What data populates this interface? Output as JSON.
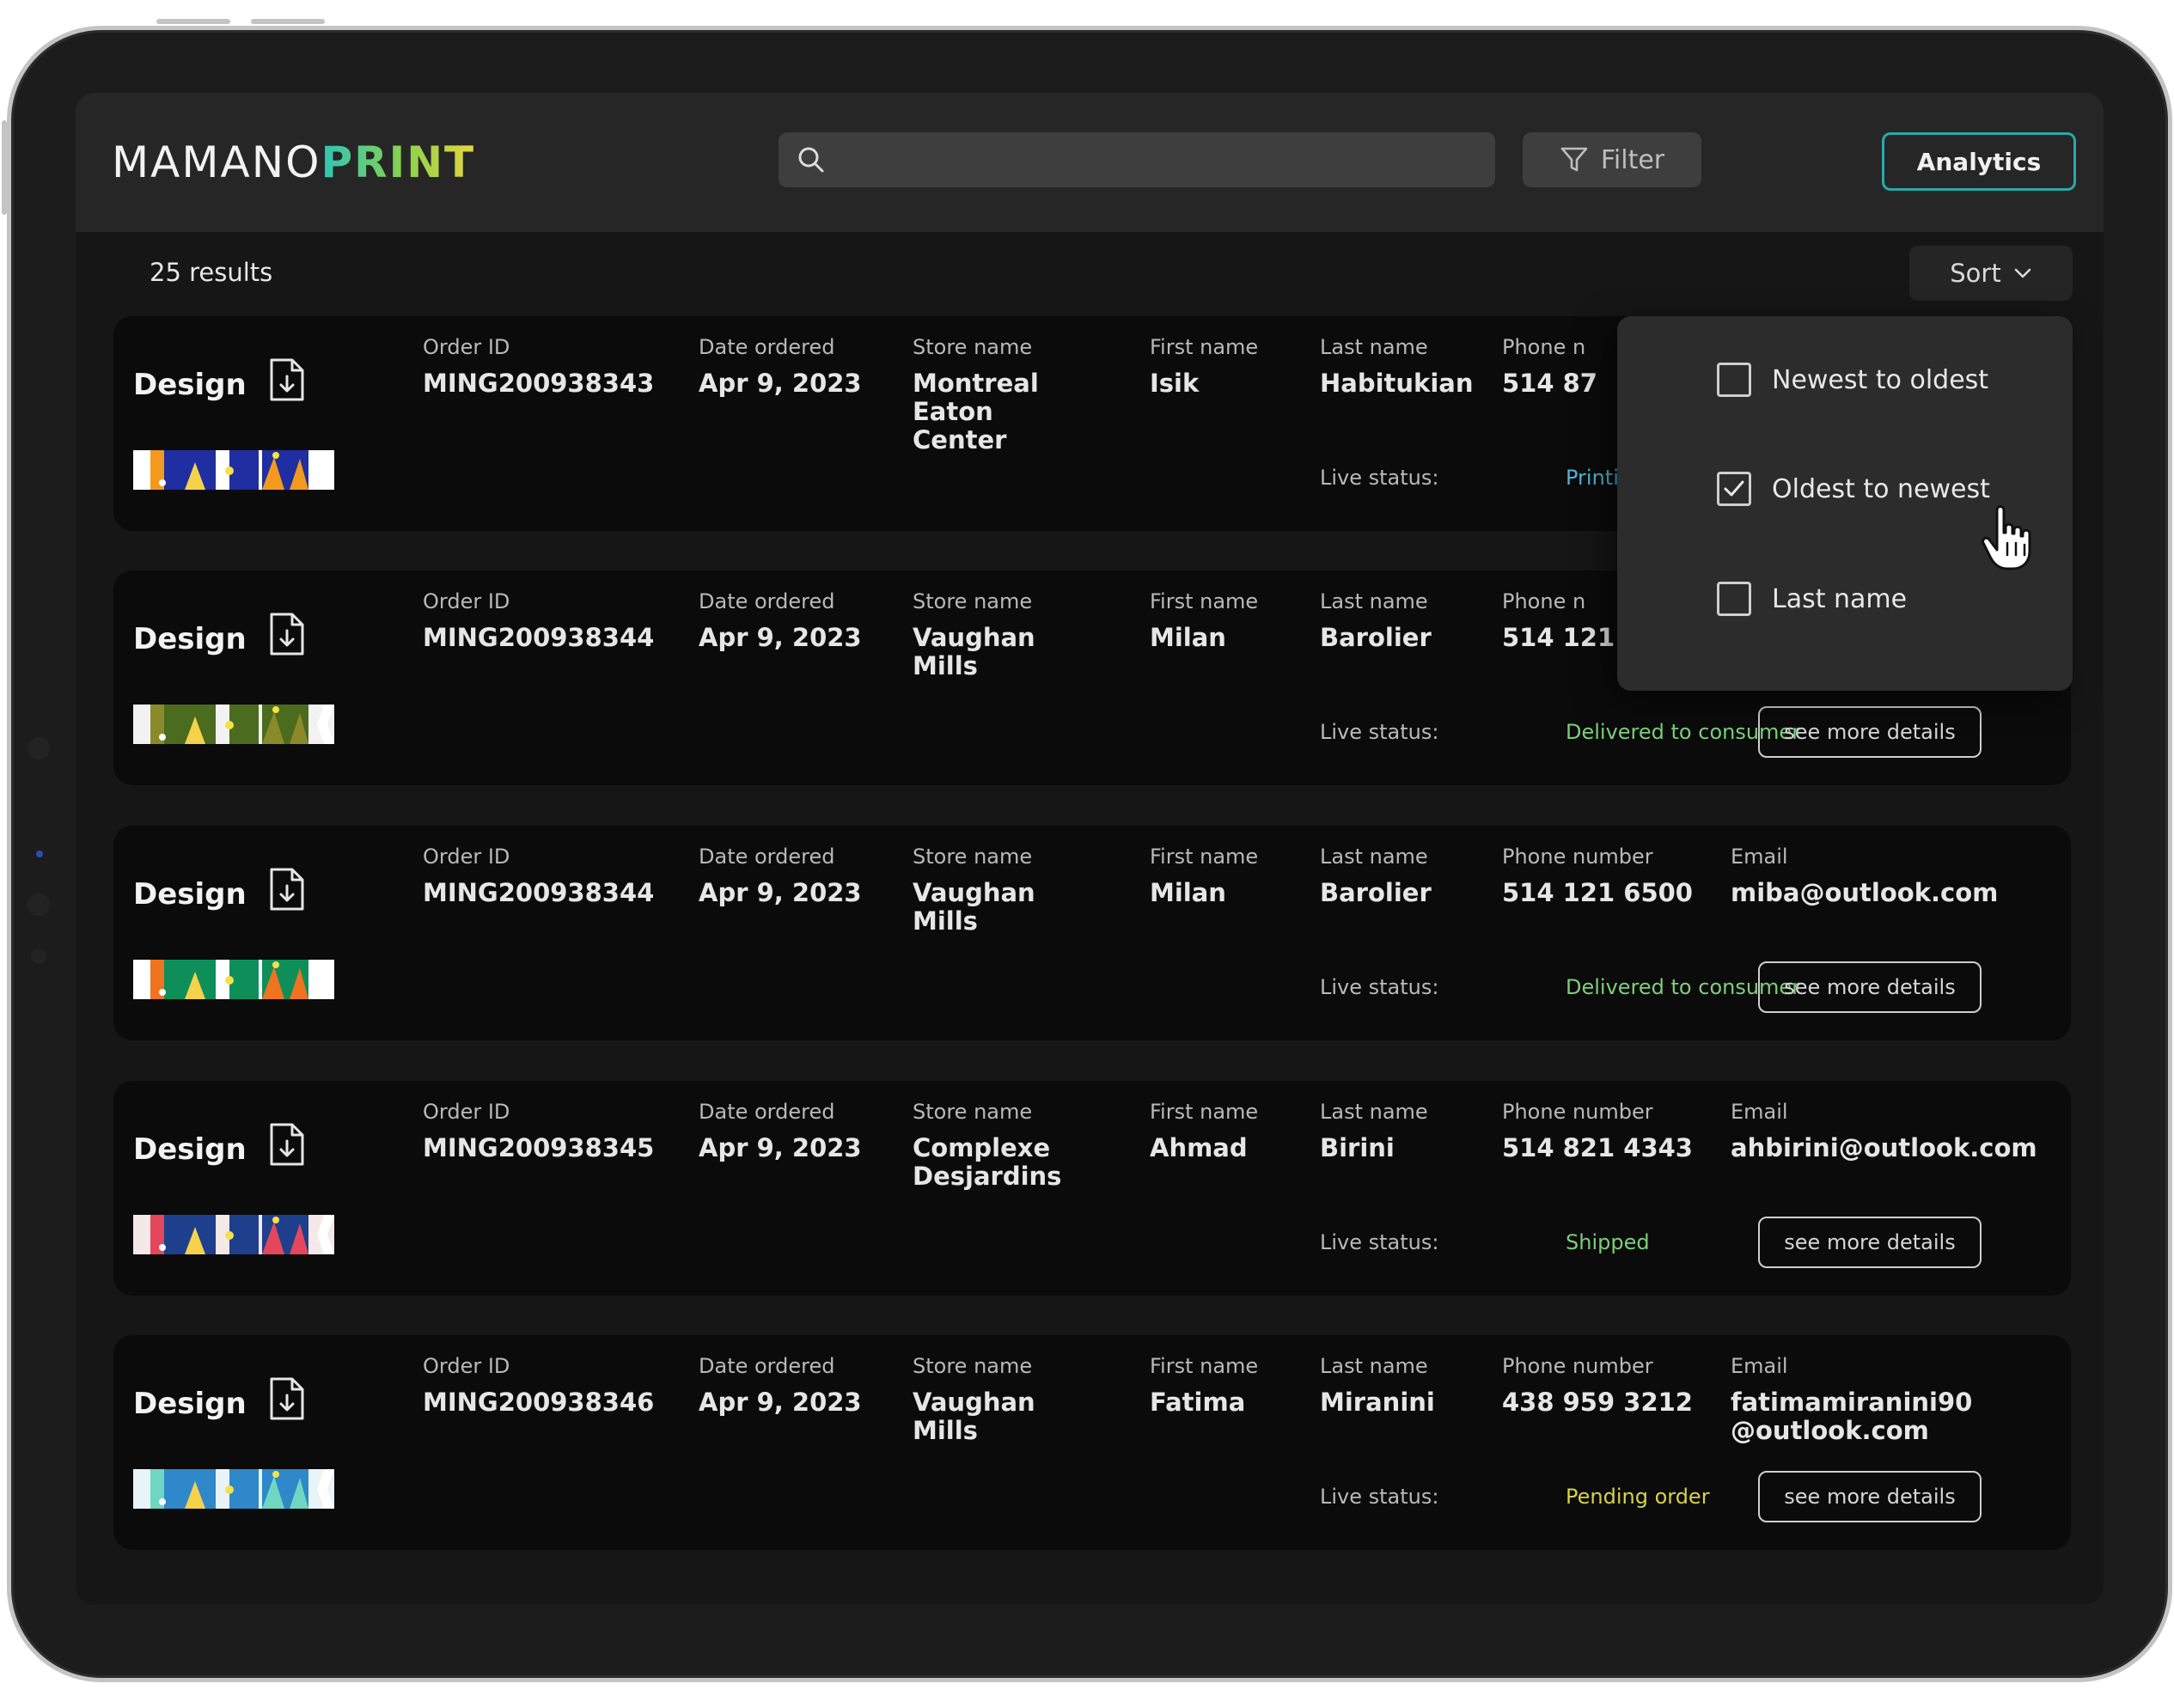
{
  "brand": {
    "part1": "MAMANO",
    "part2": "PRINT"
  },
  "header": {
    "search_placeholder": "",
    "filter_label": "Filter",
    "analytics_label": "Analytics"
  },
  "toolbar": {
    "results_text": "25 results",
    "sort_label": "Sort"
  },
  "columns": {
    "order_id": "Order ID",
    "date_ordered": "Date ordered",
    "store_name": "Store name",
    "first_name": "First name",
    "last_name": "Last name",
    "phone": "Phone number",
    "email": "Email",
    "live_status": "Live status:",
    "design": "Design",
    "details_button": "see more details"
  },
  "cards": [
    {
      "order_id": "MING200938343",
      "date": "Apr 9, 2023",
      "store": "Montreal Eaton Center",
      "first": "Isik",
      "last": "Habitukian",
      "phone": "514 87",
      "phone_label": "Phone n",
      "email": "",
      "status": "Printing com",
      "status_color": "#4fb6d6"
    },
    {
      "order_id": "MING200938344",
      "date": "Apr 9, 2023",
      "store": "Vaughan Mills",
      "first": "Milan",
      "last": "Barolier",
      "phone": "514 121",
      "phone_label": "Phone n",
      "email": "",
      "status": "Delivered to consumer",
      "status_color": "#7ccf7a"
    },
    {
      "order_id": "MING200938344",
      "date": "Apr 9, 2023",
      "store": "Vaughan Mills",
      "first": "Milan",
      "last": "Barolier",
      "phone": "514 121 6500",
      "phone_label": "Phone number",
      "email": "miba@outlook.com",
      "status": "Delivered to consumer",
      "status_color": "#7ccf7a"
    },
    {
      "order_id": "MING200938345",
      "date": "Apr 9, 2023",
      "store": "Complexe Desjardins",
      "first": "Ahmad",
      "last": "Birini",
      "phone": "514 821 4343",
      "phone_label": "Phone number",
      "email": "ahbirini@outlook.com",
      "status": "Shipped",
      "status_color": "#7ccf7a"
    },
    {
      "order_id": "MING200938346",
      "date": "Apr 9, 2023",
      "store": "Vaughan Mills",
      "first": "Fatima",
      "last": "Miranini",
      "phone": "438 959 3212",
      "phone_label": "Phone number",
      "email": "fatimamiranini90 @outlook.com",
      "status": "Pending order",
      "status_color": "#d6d24a"
    }
  ],
  "sort_menu": {
    "options": [
      {
        "label": "Newest to oldest",
        "checked": false
      },
      {
        "label": "Oldest to newest",
        "checked": true
      },
      {
        "label": "Last name",
        "checked": false
      }
    ]
  },
  "colors": {
    "accent": "#2aa9a8",
    "background": "#161616",
    "card": "#0b0b0b"
  },
  "icons": [
    "search-icon",
    "filter-icon",
    "chevron-down-icon",
    "download-file-icon",
    "checkmark-icon",
    "hand-pointer-icon"
  ]
}
